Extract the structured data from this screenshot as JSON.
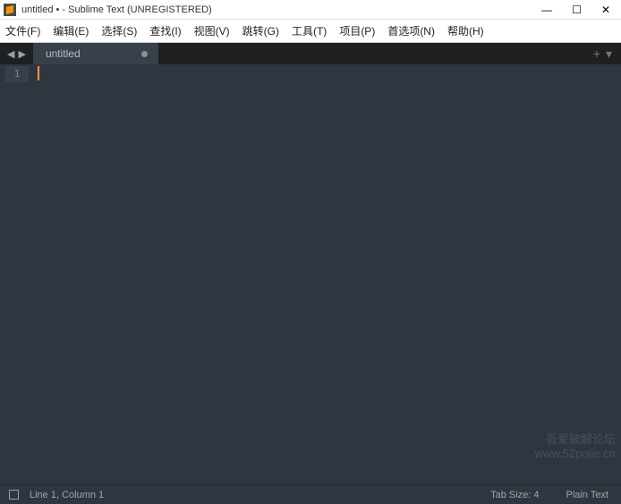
{
  "window": {
    "title": "untitled • - Sublime Text (UNREGISTERED)"
  },
  "menu": {
    "file": "文件(F)",
    "edit": "编辑(E)",
    "select": "选择(S)",
    "find": "查找(I)",
    "view": "视图(V)",
    "goto": "跳转(G)",
    "tools": "工具(T)",
    "project": "项目(P)",
    "preferences": "首选项(N)",
    "help": "帮助(H)"
  },
  "tabs": {
    "current": "untitled"
  },
  "gutter": {
    "line1": "1"
  },
  "status": {
    "position": "Line 1, Column 1",
    "tab_size": "Tab Size: 4",
    "syntax": "Plain Text"
  },
  "watermark": {
    "line1": "吾爱破解论坛",
    "line2": "www.52pojie.cn"
  }
}
